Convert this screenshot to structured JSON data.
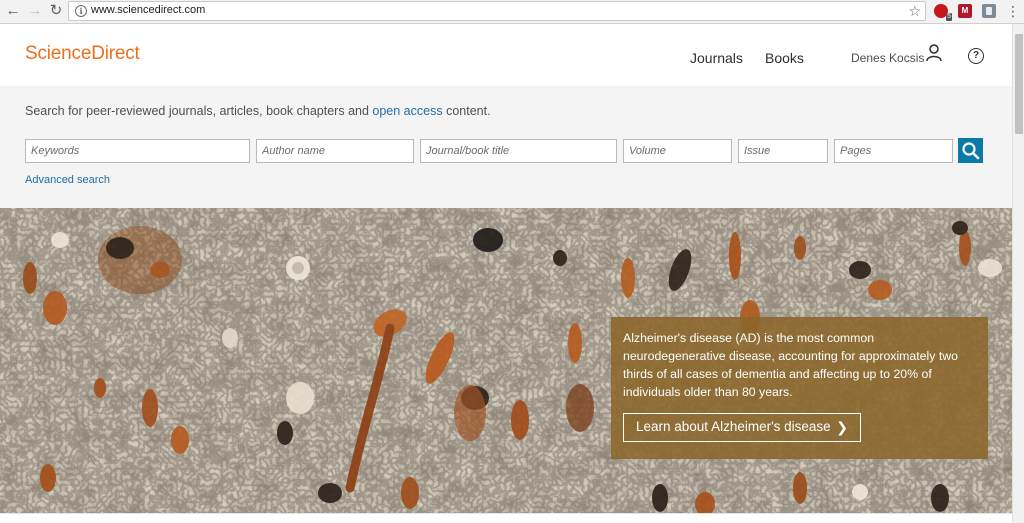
{
  "browser": {
    "back_glyph": "←",
    "forward_glyph": "→",
    "reload_glyph": "↻",
    "url": "www.sciencedirect.com",
    "ext_badge": "5",
    "ext2_label": "M"
  },
  "header": {
    "logo": "ScienceDirect",
    "nav": [
      "Journals",
      "Books"
    ],
    "user_name": "Denes Kocsis",
    "help_glyph": "?"
  },
  "search": {
    "intro_before": "Search for peer-reviewed journals, articles, book chapters and ",
    "intro_link": "open access",
    "intro_after": " content.",
    "fields": {
      "keywords": "Keywords",
      "author": "Author name",
      "journal": "Journal/book title",
      "volume": "Volume",
      "issue": "Issue",
      "pages": "Pages"
    },
    "advanced_label": "Advanced search"
  },
  "hero": {
    "text": "Alzheimer's disease (AD) is the most common neurodegenerative disease, accounting for approximately two thirds of all cases of dementia and affecting up to 20% of individuals older than 80 years.",
    "button_label": "Learn about Alzheimer's disease",
    "button_chevron": "❯"
  },
  "colors": {
    "brand_orange": "#e9711c",
    "link_blue": "#1f6ea4",
    "search_button": "#0a7ba6",
    "hero_panel": "#8b672a"
  }
}
